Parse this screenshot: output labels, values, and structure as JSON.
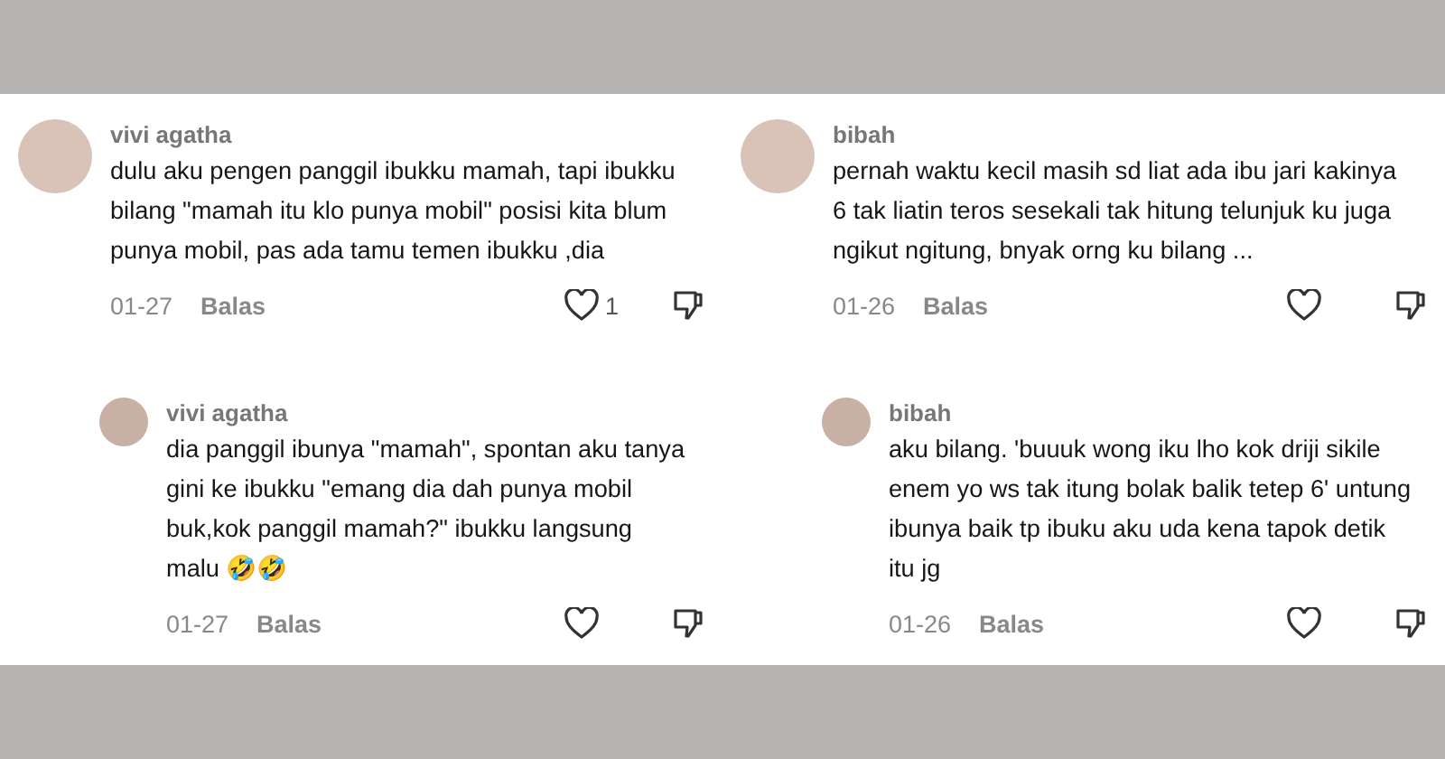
{
  "columns": [
    {
      "comments": [
        {
          "kind": "comment",
          "author": "vivi agatha",
          "text": "dulu aku pengen panggil ibukku mamah, tapi ibukku bilang \"mamah itu klo punya mobil\" posisi kita blum punya mobil, pas ada tamu temen ibukku ,dia",
          "date": "01-27",
          "reply_label": "Balas",
          "likes": "1"
        },
        {
          "kind": "reply",
          "author": "vivi agatha",
          "text": "dia panggil ibunya \"mamah\", spontan aku tanya gini ke ibukku \"emang dia dah punya mobil buk,kok panggil mamah?\" ibukku langsung malu 🤣🤣",
          "date": "01-27",
          "reply_label": "Balas"
        }
      ]
    },
    {
      "comments": [
        {
          "kind": "comment",
          "author": "bibah",
          "text": "pernah waktu kecil masih sd liat ada ibu jari kakinya 6 tak liatin teros sesekali tak hitung telunjuk ku juga ngikut ngitung, bnyak orng ku bilang ...",
          "date": "01-26",
          "reply_label": "Balas"
        },
        {
          "kind": "reply",
          "author": "bibah",
          "text": "aku bilang. 'buuuk wong iku lho kok driji sikile enem yo ws tak itung bolak balik tetep 6' untung ibunya baik tp ibuku aku uda kena tapok detik itu jg",
          "date": "01-26",
          "reply_label": "Balas"
        }
      ]
    }
  ]
}
